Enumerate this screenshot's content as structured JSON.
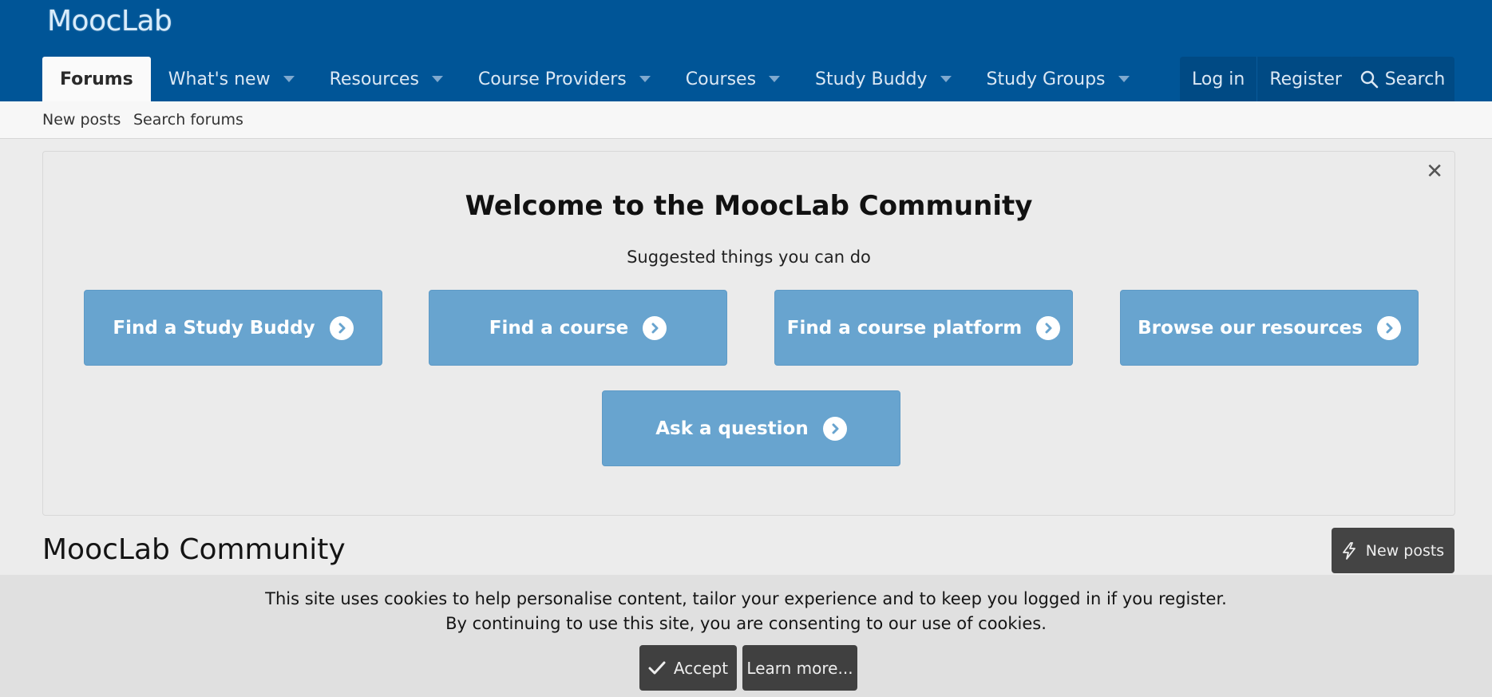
{
  "header": {
    "logo": "MoocLab",
    "nav": [
      {
        "label": "Forums",
        "active": true,
        "has_menu": false
      },
      {
        "label": "What's new",
        "active": false,
        "has_menu": true
      },
      {
        "label": "Resources",
        "active": false,
        "has_menu": true
      },
      {
        "label": "Course Providers",
        "active": false,
        "has_menu": true
      },
      {
        "label": "Courses",
        "active": false,
        "has_menu": true
      },
      {
        "label": "Study Buddy",
        "active": false,
        "has_menu": true
      },
      {
        "label": "Study Groups",
        "active": false,
        "has_menu": true
      }
    ],
    "login_label": "Log in",
    "register_label": "Register",
    "search_label": "Search",
    "search_icon": "search-icon"
  },
  "sub_nav": {
    "new_posts_label": "New posts",
    "search_forums_label": "Search forums"
  },
  "welcome": {
    "close_icon": "close-icon",
    "title": "Welcome to the MoocLab Community",
    "subtitle": "Suggested things you can do",
    "actions": [
      {
        "label": "Find a Study Buddy",
        "icon": "chevron-circle-right-icon"
      },
      {
        "label": "Find a course",
        "icon": "chevron-circle-right-icon"
      },
      {
        "label": "Find a course platform",
        "icon": "chevron-circle-right-icon"
      },
      {
        "label": "Browse our resources",
        "icon": "chevron-circle-right-icon"
      },
      {
        "label": "Ask a question",
        "icon": "chevron-circle-right-icon"
      }
    ]
  },
  "main": {
    "title": "MoocLab Community",
    "new_posts_button": "New posts",
    "new_posts_icon": "bolt-icon"
  },
  "cookie": {
    "line1": "This site uses cookies to help personalise content, tailor your experience and to keep you logged in if you register.",
    "line2": "By continuing to use this site, you are consenting to our use of cookies.",
    "accept_label": "Accept",
    "accept_icon": "check-icon",
    "learn_more_label": "Learn more..."
  },
  "colors": {
    "header_bg": "#005597",
    "action_button_bg": "#68a4cf",
    "dark_button_bg": "#444444"
  }
}
